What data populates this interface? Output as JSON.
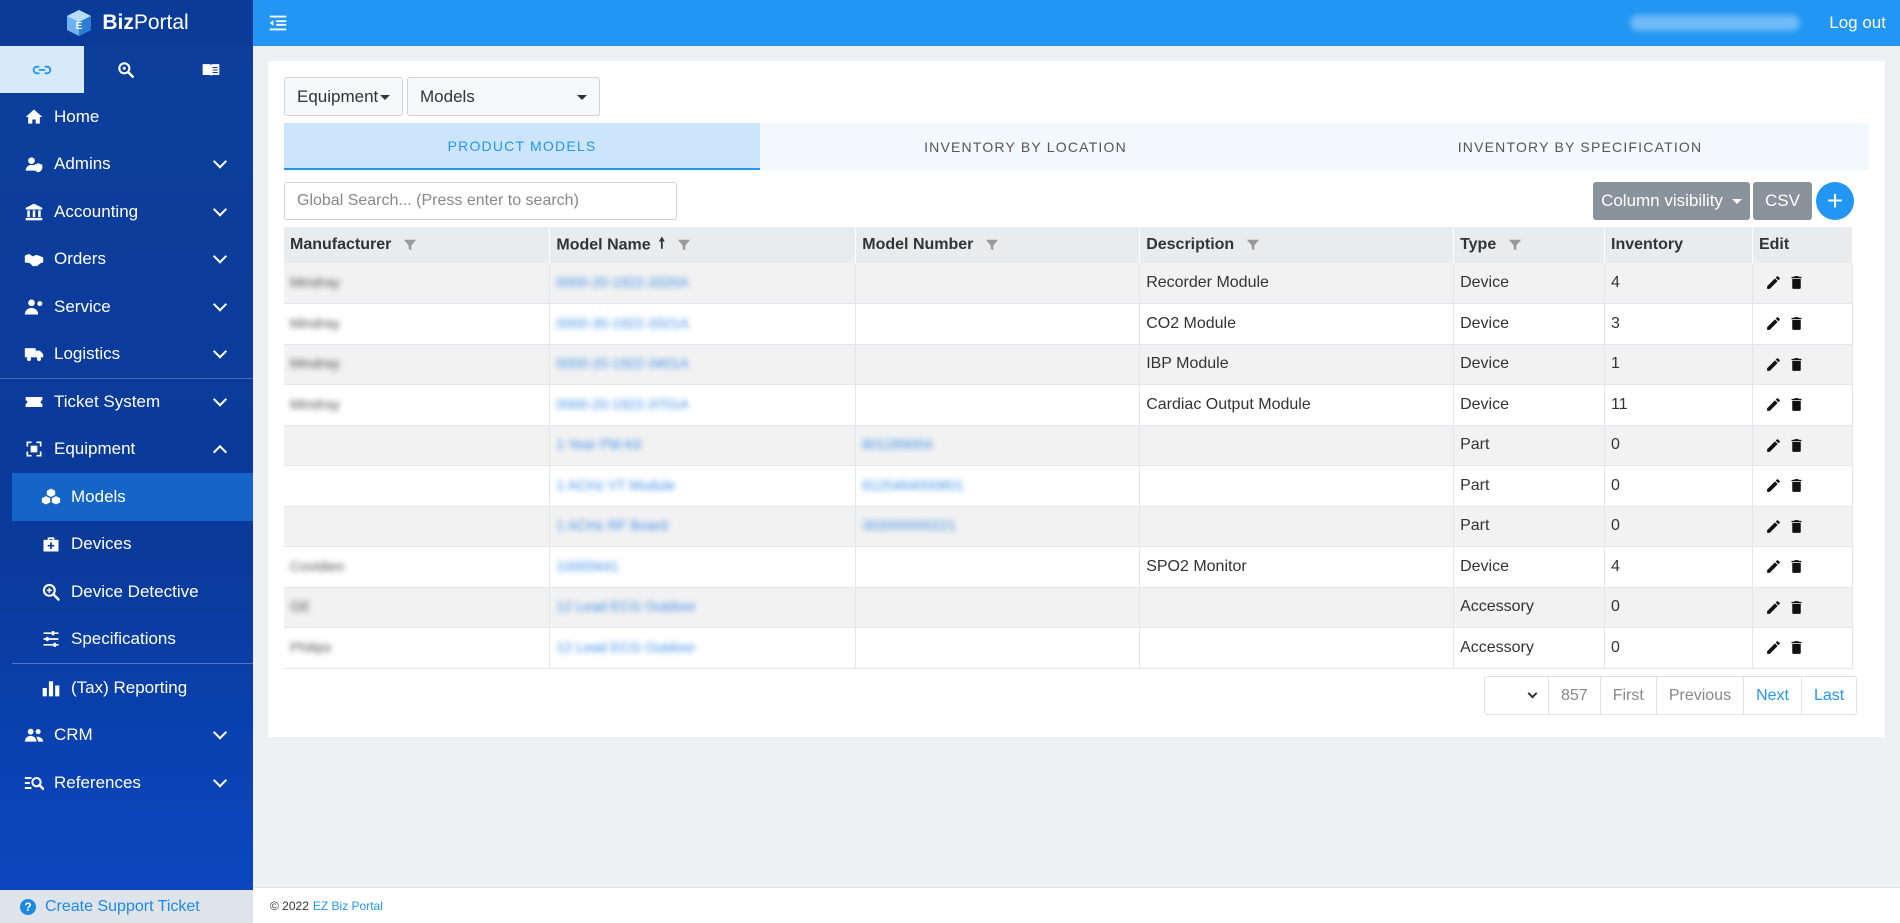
{
  "brand": {
    "name_bold": "Biz",
    "name_rest": "Portal"
  },
  "topbar": {
    "logout_label": "Log out"
  },
  "sidebar": {
    "tabs": [
      {
        "icon": "link-icon"
      },
      {
        "icon": "search-zoom-icon"
      },
      {
        "icon": "book-icon"
      }
    ],
    "items": [
      {
        "label": "Home",
        "icon": "home-icon"
      },
      {
        "label": "Admins",
        "icon": "admin-shield-icon"
      },
      {
        "label": "Accounting",
        "icon": "bank-icon"
      },
      {
        "label": "Orders",
        "icon": "handshake-icon"
      },
      {
        "label": "Service",
        "icon": "service-user-icon"
      },
      {
        "label": "Logistics",
        "icon": "truck-icon"
      },
      {
        "label": "Ticket System",
        "icon": "ticket-icon"
      },
      {
        "label": "Equipment",
        "icon": "equipment-icon"
      }
    ],
    "sub_items": [
      {
        "label": "Models",
        "icon": "cubes-icon"
      },
      {
        "label": "Devices",
        "icon": "medkit-icon"
      },
      {
        "label": "Device Detective",
        "icon": "search-plus-icon"
      },
      {
        "label": "Specifications",
        "icon": "sliders-icon"
      },
      {
        "label": "(Tax) Reporting",
        "icon": "bar-chart-icon"
      }
    ],
    "bottom_items": [
      {
        "label": "CRM",
        "icon": "users-icon"
      },
      {
        "label": "References",
        "icon": "list-search-icon"
      }
    ],
    "support_label": "Create Support Ticket"
  },
  "filters": {
    "category": "Equipment",
    "view": "Models"
  },
  "tabs": [
    "PRODUCT MODELS",
    "INVENTORY BY LOCATION",
    "INVENTORY BY SPECIFICATION"
  ],
  "search": {
    "placeholder": "Global Search... (Press enter to search)"
  },
  "toolbar": {
    "column_visibility": "Column visibility",
    "csv": "CSV",
    "add": "+"
  },
  "table": {
    "headers": [
      "Manufacturer",
      "Model Name",
      "Model Number",
      "Description",
      "Type",
      "Inventory",
      "Edit"
    ],
    "rows": [
      {
        "manufacturer": "Mindray",
        "model_name": "0000-20-1922-3320A",
        "model_number": "",
        "description": "Recorder Module",
        "type": "Device",
        "inventory": "4"
      },
      {
        "manufacturer": "Mindray",
        "model_name": "0000-30-1922-3321A",
        "model_number": "",
        "description": "CO2 Module",
        "type": "Device",
        "inventory": "3"
      },
      {
        "manufacturer": "Mindray",
        "model_name": "0000-20-1922-3401A",
        "model_number": "",
        "description": "IBP Module",
        "type": "Device",
        "inventory": "1"
      },
      {
        "manufacturer": "Mindray",
        "model_name": "0000-20-1922-3701A",
        "model_number": "",
        "description": "Cardiac Output Module",
        "type": "Device",
        "inventory": "11"
      },
      {
        "manufacturer": "",
        "model_name": "1 Year PM Kit",
        "model_number": "801289004",
        "description": "",
        "type": "Part",
        "inventory": "0"
      },
      {
        "manufacturer": "",
        "model_name": "1 ACHz VT Module",
        "model_number": "8125464000801",
        "description": "",
        "type": "Part",
        "inventory": "0"
      },
      {
        "manufacturer": "",
        "model_name": "1 ACHz RF Board",
        "model_number": "302000000221",
        "description": "",
        "type": "Part",
        "inventory": "0"
      },
      {
        "manufacturer": "Covidien",
        "model_name": "10005641",
        "model_number": "",
        "description": "SPO2 Monitor",
        "type": "Device",
        "inventory": "4"
      },
      {
        "manufacturer": "GE",
        "model_name": "12 Lead ECG Outdoor",
        "model_number": "",
        "description": "",
        "type": "Accessory",
        "inventory": "0"
      },
      {
        "manufacturer": "Philips",
        "model_name": "12 Lead ECG Outdoor",
        "model_number": "",
        "description": "",
        "type": "Accessory",
        "inventory": "0"
      }
    ]
  },
  "pagination": {
    "total": "857",
    "first": "First",
    "previous": "Previous",
    "next": "Next",
    "last": "Last"
  },
  "footer": {
    "copyright": "© 2022",
    "link": "EZ Biz Portal"
  },
  "colors": {
    "primary": "#2196f3",
    "sidebar": "#0a3a9a",
    "active_tab_bg": "#cce5fa",
    "grey_button": "#8a939b"
  }
}
